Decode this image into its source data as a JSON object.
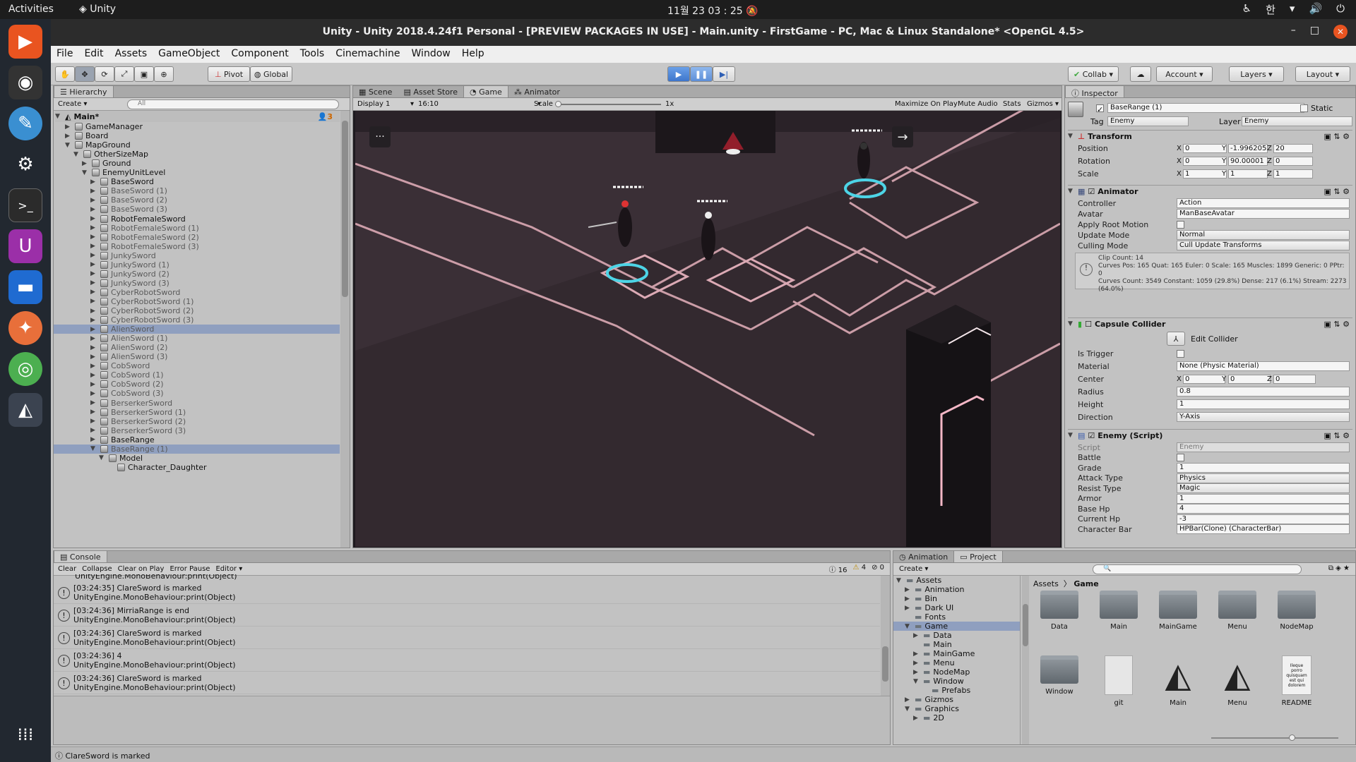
{
  "os": {
    "activities": "Activities",
    "app": "Unity",
    "clock": "11월 23  03 : 25",
    "ime": "한"
  },
  "window": {
    "title": "Unity - Unity 2018.4.24f1 Personal - [PREVIEW PACKAGES IN USE] - Main.unity - FirstGame - PC, Mac & Linux Standalone* <OpenGL 4.5>"
  },
  "menu": [
    "File",
    "Edit",
    "Assets",
    "GameObject",
    "Component",
    "Tools",
    "Cinemachine",
    "Window",
    "Help"
  ],
  "toolbar": {
    "pivot": "Pivot",
    "global": "Global",
    "collab": "Collab",
    "account": "Account",
    "layers": "Layers",
    "layout": "Layout"
  },
  "hierarchy": {
    "tab": "Hierarchy",
    "create": "Create",
    "search_placeholder": "All",
    "scene": "Main*",
    "count": "3",
    "items": [
      {
        "label": "GameManager",
        "d": 1,
        "e": "r"
      },
      {
        "label": "Board",
        "d": 1,
        "e": "r"
      },
      {
        "label": "MapGround",
        "d": 1,
        "e": "d"
      },
      {
        "label": "OtherSizeMap",
        "d": 2,
        "e": "d"
      },
      {
        "label": "Ground",
        "d": 3,
        "e": "r"
      },
      {
        "label": "EnemyUnitLevel",
        "d": 3,
        "e": "d"
      },
      {
        "label": "BaseSword",
        "d": 4,
        "e": "r"
      },
      {
        "label": "BaseSword (1)",
        "d": 4,
        "e": "r",
        "g": 1
      },
      {
        "label": "BaseSword (2)",
        "d": 4,
        "e": "r",
        "g": 1
      },
      {
        "label": "BaseSword (3)",
        "d": 4,
        "e": "r",
        "g": 1
      },
      {
        "label": "RobotFemaleSword",
        "d": 4,
        "e": "r"
      },
      {
        "label": "RobotFemaleSword (1)",
        "d": 4,
        "e": "r",
        "g": 1
      },
      {
        "label": "RobotFemaleSword (2)",
        "d": 4,
        "e": "r",
        "g": 1
      },
      {
        "label": "RobotFemaleSword (3)",
        "d": 4,
        "e": "r",
        "g": 1
      },
      {
        "label": "JunkySword",
        "d": 4,
        "e": "r",
        "g": 1
      },
      {
        "label": "JunkySword (1)",
        "d": 4,
        "e": "r",
        "g": 1
      },
      {
        "label": "JunkySword (2)",
        "d": 4,
        "e": "r",
        "g": 1
      },
      {
        "label": "JunkySword (3)",
        "d": 4,
        "e": "r",
        "g": 1
      },
      {
        "label": "CyberRobotSword",
        "d": 4,
        "e": "r",
        "g": 1
      },
      {
        "label": "CyberRobotSword (1)",
        "d": 4,
        "e": "r",
        "g": 1
      },
      {
        "label": "CyberRobotSword (2)",
        "d": 4,
        "e": "r",
        "g": 1
      },
      {
        "label": "CyberRobotSword (3)",
        "d": 4,
        "e": "r",
        "g": 1
      },
      {
        "label": "AlienSword",
        "d": 4,
        "e": "r",
        "g": 1,
        "s": 1
      },
      {
        "label": "AlienSword (1)",
        "d": 4,
        "e": "r",
        "g": 1
      },
      {
        "label": "AlienSword (2)",
        "d": 4,
        "e": "r",
        "g": 1
      },
      {
        "label": "AlienSword (3)",
        "d": 4,
        "e": "r",
        "g": 1
      },
      {
        "label": "CobSword",
        "d": 4,
        "e": "r",
        "g": 1
      },
      {
        "label": "CobSword (1)",
        "d": 4,
        "e": "r",
        "g": 1
      },
      {
        "label": "CobSword (2)",
        "d": 4,
        "e": "r",
        "g": 1
      },
      {
        "label": "CobSword (3)",
        "d": 4,
        "e": "r",
        "g": 1
      },
      {
        "label": "BerserkerSword",
        "d": 4,
        "e": "r",
        "g": 1
      },
      {
        "label": "BerserkerSword (1)",
        "d": 4,
        "e": "r",
        "g": 1
      },
      {
        "label": "BerserkerSword (2)",
        "d": 4,
        "e": "r",
        "g": 1
      },
      {
        "label": "BerserkerSword (3)",
        "d": 4,
        "e": "r",
        "g": 1
      },
      {
        "label": "BaseRange",
        "d": 4,
        "e": "r"
      },
      {
        "label": "BaseRange (1)",
        "d": 4,
        "e": "d",
        "g": 1,
        "s": 1
      },
      {
        "label": "Model",
        "d": 5,
        "e": "d"
      },
      {
        "label": "Character_Daughter",
        "d": 6,
        "e": ""
      }
    ]
  },
  "game": {
    "tabs": [
      "Scene",
      "Asset Store",
      "Game",
      "Animator"
    ],
    "display": "Display 1",
    "aspect": "16:10",
    "scale_label": "Scale",
    "scale_value": "1x",
    "options": [
      "Maximize On Play",
      "Mute Audio",
      "Stats",
      "Gizmos"
    ],
    "menu_dots": "···",
    "arrow": "→"
  },
  "inspector": {
    "tab": "Inspector",
    "name": "BaseRange (1)",
    "static": "Static",
    "tag_label": "Tag",
    "tag": "Enemy",
    "layer_label": "Layer",
    "layer": "Enemy",
    "transform": {
      "title": "Transform",
      "pos_label": "Position",
      "rot_label": "Rotation",
      "scale_label": "Scale",
      "position": [
        "0",
        "-1.996205",
        "20"
      ],
      "rotation": [
        "0",
        "90.00001",
        "0"
      ],
      "scale": [
        "1",
        "1",
        "1"
      ]
    },
    "animator": {
      "title": "Animator",
      "rows": [
        [
          "Controller",
          "Action"
        ],
        [
          "Avatar",
          "ManBaseAvatar"
        ],
        [
          "Apply Root Motion",
          ""
        ],
        [
          "Update Mode",
          "Normal"
        ],
        [
          "Culling Mode",
          "Cull Update Transforms"
        ]
      ],
      "info": "Clip Count: 14\nCurves Pos: 165 Quat: 165 Euler: 0 Scale: 165 Muscles: 1899 Generic: 0 PPtr: 0\nCurves Count: 3549 Constant: 1059 (29.8%) Dense: 217 (6.1%) Stream: 2273 (64.0%)"
    },
    "collider": {
      "title": "Capsule Collider",
      "edit": "Edit Collider",
      "trigger": "Is Trigger",
      "material_label": "Material",
      "material": "None (Physic Material)",
      "center_label": "Center",
      "center": [
        "0",
        "0",
        "0"
      ],
      "radius_label": "Radius",
      "radius": "0.8",
      "height_label": "Height",
      "height": "1",
      "direction_label": "Direction",
      "direction": "Y-Axis"
    },
    "enemy": {
      "title": "Enemy (Script)",
      "rows": [
        [
          "Script",
          "Enemy"
        ],
        [
          "Battle",
          ""
        ],
        [
          "Grade",
          "1"
        ],
        [
          "Attack Type",
          "Physics"
        ],
        [
          "Resist Type",
          "Magic"
        ],
        [
          "Armor",
          "1"
        ],
        [
          "Base Hp",
          "4"
        ],
        [
          "Current Hp",
          "-3"
        ],
        [
          "Character Bar",
          "HPBar(Clone) (CharacterBar)"
        ]
      ]
    }
  },
  "console": {
    "tab": "Console",
    "buttons": [
      "Clear",
      "Collapse",
      "Clear on Play",
      "Error Pause",
      "Editor"
    ],
    "counts": [
      "16",
      "4",
      "0"
    ],
    "cut": "UnityEngine.MonoBehaviour:print(Object)",
    "entries": [
      [
        "[03:24:35] ClareSword is marked",
        "UnityEngine.MonoBehaviour:print(Object)"
      ],
      [
        "[03:24:36] MirriaRange is end",
        "UnityEngine.MonoBehaviour:print(Object)"
      ],
      [
        "[03:24:36] ClareSword is marked",
        "UnityEngine.MonoBehaviour:print(Object)"
      ],
      [
        "[03:24:36] 4",
        "UnityEngine.MonoBehaviour:print(Object)"
      ],
      [
        "[03:24:36] ClareSword is marked",
        "UnityEngine.MonoBehaviour:print(Object)"
      ]
    ],
    "status": "ClareSword is marked"
  },
  "project": {
    "tabs": [
      "Animation",
      "Project"
    ],
    "create": "Create",
    "tree": [
      [
        "Assets",
        0,
        "d"
      ],
      [
        "Animation",
        1,
        "r"
      ],
      [
        "Bin",
        1,
        "r"
      ],
      [
        "Dark UI",
        1,
        "r"
      ],
      [
        "Fonts",
        1,
        ""
      ],
      [
        "Game",
        1,
        "d",
        1
      ],
      [
        "Data",
        2,
        "r"
      ],
      [
        "Main",
        2,
        ""
      ],
      [
        "MainGame",
        2,
        "r"
      ],
      [
        "Menu",
        2,
        "r"
      ],
      [
        "NodeMap",
        2,
        "r"
      ],
      [
        "Window",
        2,
        "d"
      ],
      [
        "Prefabs",
        3,
        ""
      ],
      [
        "Gizmos",
        1,
        "r"
      ],
      [
        "Graphics",
        1,
        "d"
      ],
      [
        "2D",
        2,
        "r"
      ]
    ],
    "breadcrumb": [
      "Assets",
      "Game"
    ],
    "assets": [
      [
        "Data",
        "folder"
      ],
      [
        "Main",
        "folder"
      ],
      [
        "MainGame",
        "folder"
      ],
      [
        "Menu",
        "folder"
      ],
      [
        "NodeMap",
        "folder"
      ],
      [
        "Window",
        "folder"
      ],
      [
        "git",
        "file"
      ],
      [
        "Main",
        "unity"
      ],
      [
        "Menu",
        "unity"
      ],
      [
        "README",
        "doc"
      ]
    ],
    "readme_text": "Ileque porro quisquam est qui dolorem"
  }
}
